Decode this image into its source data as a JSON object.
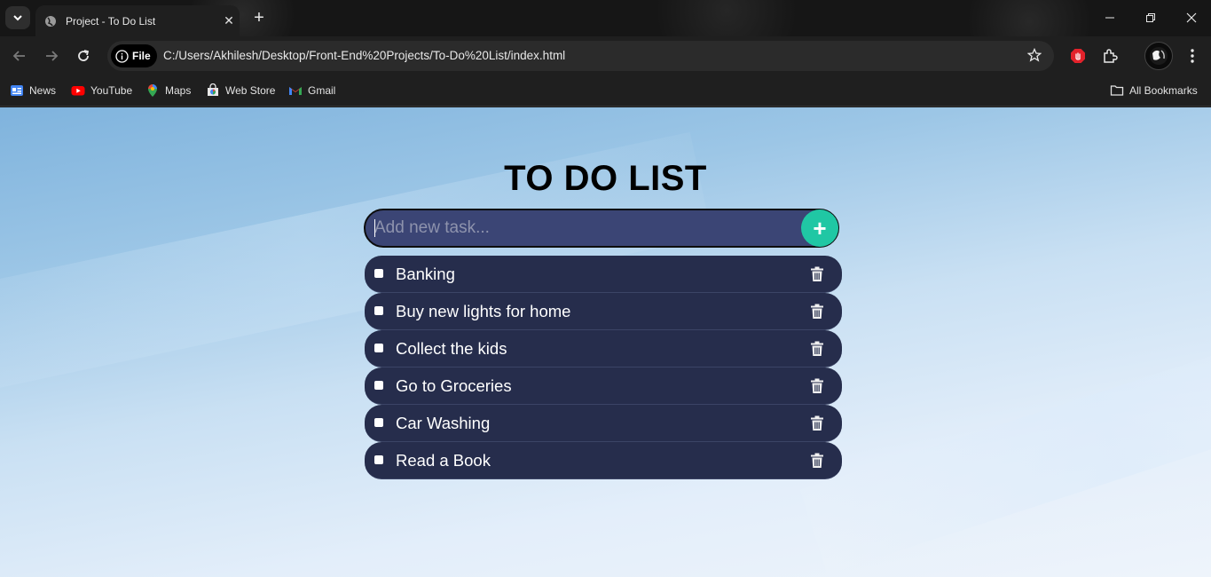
{
  "browser": {
    "tab_title": "Project - To Do List",
    "address_chip_label": "File",
    "url": "C:/Users/Akhilesh/Desktop/Front-End%20Projects/To-Do%20List/index.html",
    "bookmarks": [
      {
        "label": "News",
        "icon": "news-icon"
      },
      {
        "label": "YouTube",
        "icon": "youtube-icon"
      },
      {
        "label": "Maps",
        "icon": "maps-icon"
      },
      {
        "label": "Web Store",
        "icon": "web-store-icon"
      },
      {
        "label": "Gmail",
        "icon": "gmail-icon"
      }
    ],
    "all_bookmarks_label": "All Bookmarks"
  },
  "app": {
    "title": "TO DO LIST",
    "input": {
      "placeholder": "Add new task...",
      "value": ""
    },
    "add_button_label": "+",
    "tasks": [
      {
        "label": "Banking",
        "done": false
      },
      {
        "label": "Buy new lights for home",
        "done": false
      },
      {
        "label": "Collect the kids",
        "done": false
      },
      {
        "label": "Go to Groceries",
        "done": false
      },
      {
        "label": "Car Washing",
        "done": false
      },
      {
        "label": "Read a Book",
        "done": false
      }
    ]
  },
  "colors": {
    "task_background": "#262d4c",
    "input_background": "#3b4575",
    "add_button": "#20c7a4",
    "chrome_background": "#1f1f1f"
  }
}
